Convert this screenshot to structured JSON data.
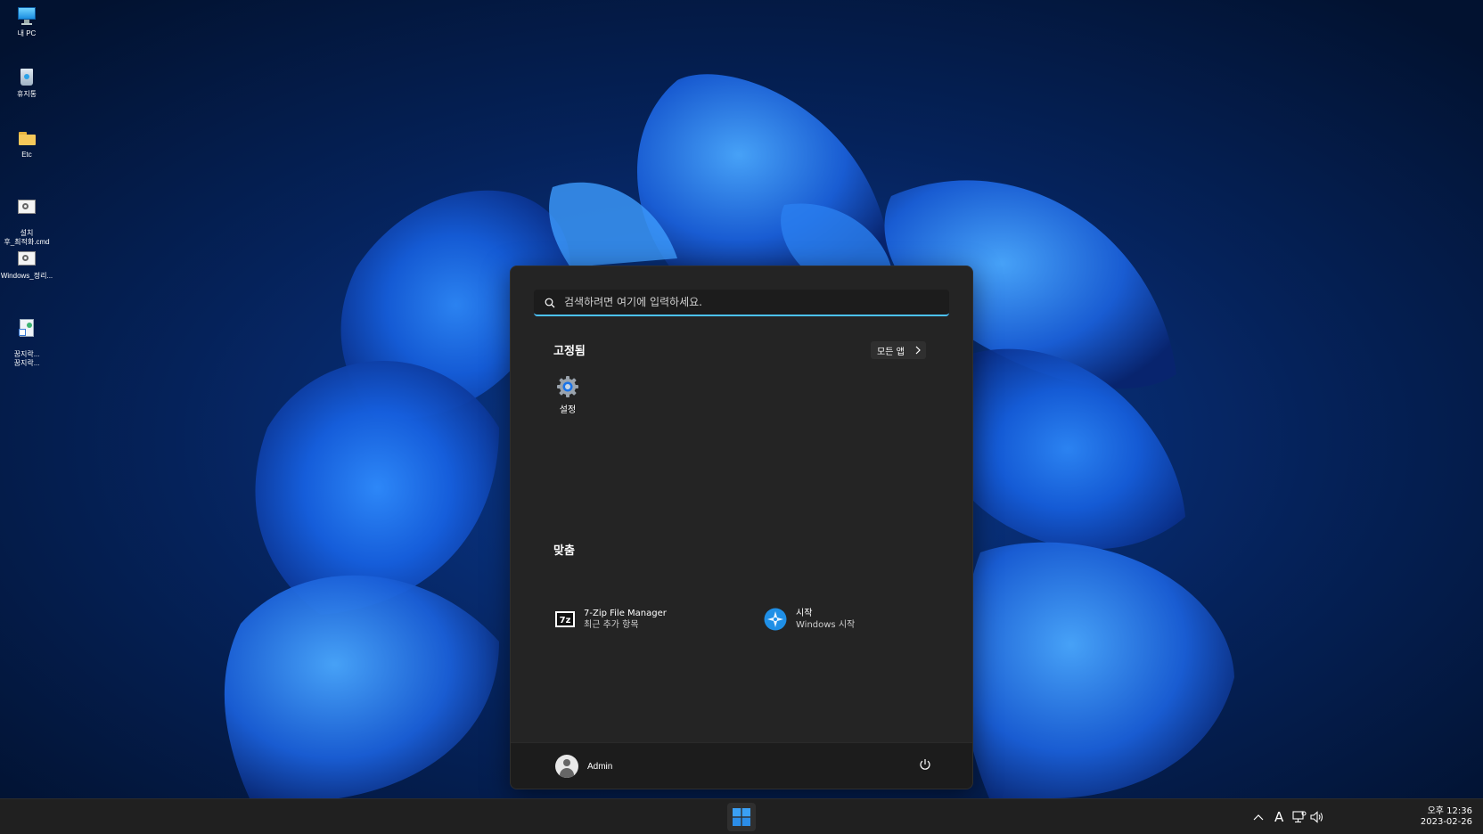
{
  "desktop": {
    "icons": [
      {
        "label": "내 PC",
        "icon": "monitor-icon"
      },
      {
        "label": "휴지통",
        "icon": "recycle-bin-icon"
      },
      {
        "label": "Etc",
        "icon": "folder-icon"
      },
      {
        "label": "설치\n후_최적화.cmd",
        "icon": "cmd-script-icon"
      },
      {
        "label": "Windows_정리...",
        "icon": "cmd-script-icon"
      },
      {
        "label": "꿈지락...\n꿈지락...",
        "icon": "shortcut-icon"
      }
    ]
  },
  "start_menu": {
    "search_placeholder": "검색하려면 여기에 입력하세요.",
    "pinned_title": "고정됨",
    "all_apps_label": "모든 앱",
    "pinned": [
      {
        "label": "설정",
        "icon": "settings-gear-icon"
      }
    ],
    "recommended_title": "맞춤",
    "recommended": [
      {
        "title": "7-Zip File Manager",
        "subtitle": "최근 추가 항목",
        "icon": "7zip-icon"
      },
      {
        "title": "시작",
        "subtitle": "Windows 시작",
        "icon": "windows-tips-icon"
      }
    ],
    "user_name": "Admin"
  },
  "taskbar": {
    "ime_label": "A",
    "clock_ampm_time": "오후 12:36",
    "clock_date": "2023-02-26"
  },
  "colors": {
    "accent": "#4cc2ff",
    "menu_bg": "#242424",
    "taskbar_bg": "#202020"
  }
}
